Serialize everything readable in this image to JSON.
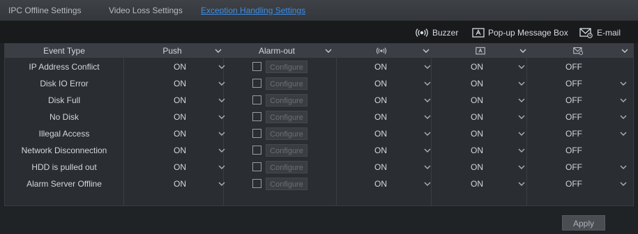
{
  "tabs": [
    {
      "label": "IPC Offline Settings",
      "active": false
    },
    {
      "label": "Video Loss Settings",
      "active": false
    },
    {
      "label": "Exception Handling Settings",
      "active": true
    }
  ],
  "legend": {
    "buzzer": {
      "icon": "buzzer-icon",
      "label": "Buzzer"
    },
    "popup": {
      "icon": "popup-message-icon",
      "label": "Pop-up Message Box"
    },
    "email": {
      "icon": "email-icon",
      "label": "E-mail"
    }
  },
  "table": {
    "headers": {
      "event_type": "Event Type",
      "push": "Push",
      "alarm_out": "Alarm-out",
      "buzzer_icon": "buzzer-icon",
      "popup_icon": "popup-message-icon",
      "email_icon": "email-icon"
    },
    "configure_label": "Configure",
    "rows": [
      {
        "event": "IP Address Conflict",
        "push": "ON",
        "buzzer": "ON",
        "popup": "ON",
        "email": "OFF",
        "email_dropdown": false
      },
      {
        "event": "Disk IO Error",
        "push": "ON",
        "buzzer": "ON",
        "popup": "ON",
        "email": "OFF",
        "email_dropdown": true
      },
      {
        "event": "Disk Full",
        "push": "ON",
        "buzzer": "ON",
        "popup": "ON",
        "email": "OFF",
        "email_dropdown": true
      },
      {
        "event": "No Disk",
        "push": "ON",
        "buzzer": "ON",
        "popup": "ON",
        "email": "OFF",
        "email_dropdown": true
      },
      {
        "event": "Illegal Access",
        "push": "ON",
        "buzzer": "ON",
        "popup": "ON",
        "email": "OFF",
        "email_dropdown": true
      },
      {
        "event": "Network Disconnection",
        "push": "ON",
        "buzzer": "ON",
        "popup": "ON",
        "email": "OFF",
        "email_dropdown": false
      },
      {
        "event": "HDD is pulled out",
        "push": "ON",
        "buzzer": "ON",
        "popup": "ON",
        "email": "OFF",
        "email_dropdown": true
      },
      {
        "event": "Alarm Server Offline",
        "push": "ON",
        "buzzer": "ON",
        "popup": "ON",
        "email": "OFF",
        "email_dropdown": true
      }
    ]
  },
  "apply_label": "Apply",
  "colors": {
    "accent": "#3d8ee6",
    "background": "#202326",
    "panel": "#2a2d31"
  }
}
